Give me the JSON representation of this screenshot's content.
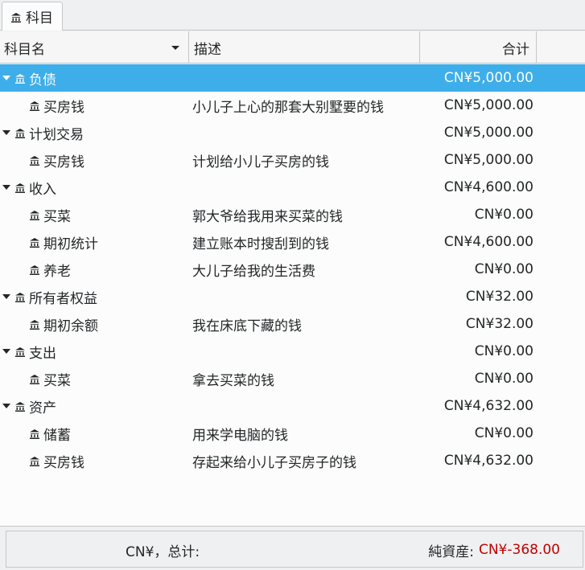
{
  "tab": {
    "label": "科目"
  },
  "header": {
    "col_name": "科目名",
    "col_desc": "描述",
    "col_total": "合计"
  },
  "rows": [
    {
      "kind": "top",
      "name": "负债",
      "desc": "",
      "total": "CN¥5,000.00",
      "selected": true
    },
    {
      "kind": "child",
      "name": "买房钱",
      "desc": "小儿子上心的那套大别墅要的钱",
      "total": "CN¥5,000.00"
    },
    {
      "kind": "top",
      "name": "计划交易",
      "desc": "",
      "total": "CN¥5,000.00"
    },
    {
      "kind": "child",
      "name": "买房钱",
      "desc": "计划给小儿子买房的钱",
      "total": "CN¥5,000.00"
    },
    {
      "kind": "top",
      "name": "收入",
      "desc": "",
      "total": "CN¥4,600.00"
    },
    {
      "kind": "child",
      "name": "买菜",
      "desc": "郭大爷给我用来买菜的钱",
      "total": "CN¥0.00"
    },
    {
      "kind": "child",
      "name": "期初统计",
      "desc": "建立账本时搜刮到的钱",
      "total": "CN¥4,600.00"
    },
    {
      "kind": "child",
      "name": "养老",
      "desc": "大儿子给我的生活费",
      "total": "CN¥0.00"
    },
    {
      "kind": "top",
      "name": "所有者权益",
      "desc": "",
      "total": "CN¥32.00"
    },
    {
      "kind": "child",
      "name": "期初余额",
      "desc": "我在床底下藏的钱",
      "total": "CN¥32.00"
    },
    {
      "kind": "top",
      "name": "支出",
      "desc": "",
      "total": "CN¥0.00"
    },
    {
      "kind": "child",
      "name": "买菜",
      "desc": "拿去买菜的钱",
      "total": "CN¥0.00"
    },
    {
      "kind": "top",
      "name": "资产",
      "desc": "",
      "total": "CN¥4,632.00"
    },
    {
      "kind": "child",
      "name": "储蓄",
      "desc": "用来学电脑的钱",
      "total": "CN¥0.00"
    },
    {
      "kind": "child",
      "name": "买房钱",
      "desc": "存起来给小儿子买房子的钱",
      "total": "CN¥4,632.00"
    }
  ],
  "footer": {
    "total_label": "CN¥，总计:",
    "net_assets_label": "純資産:",
    "net_assets_value": "CN¥-368.00",
    "negative_color": "#c00000"
  },
  "icons": {
    "account": "bank-icon",
    "expander": "expander-down-icon",
    "sort": "sort-down-icon"
  },
  "colors": {
    "selection": "#3daee9",
    "background": "#fcfcfc"
  }
}
